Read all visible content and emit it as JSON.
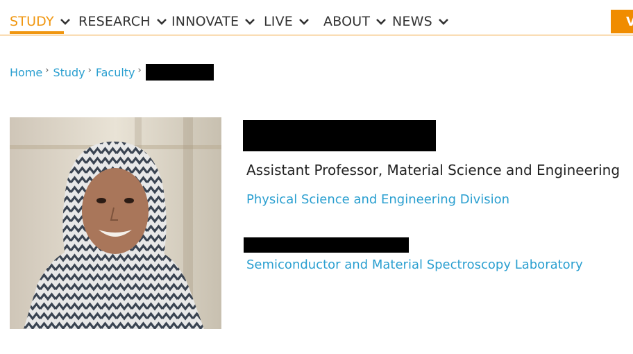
{
  "nav": {
    "items": [
      {
        "label": "STUDY",
        "active": true
      },
      {
        "label": "RESEARCH",
        "active": false
      },
      {
        "label": "INNOVATE",
        "active": false
      },
      {
        "label": "LIVE",
        "active": false
      },
      {
        "label": "ABOUT",
        "active": false
      },
      {
        "label": "NEWS",
        "active": false
      }
    ],
    "cta_label": "V"
  },
  "breadcrumb": {
    "items": [
      "Home",
      "Study",
      "Faculty"
    ],
    "separator": "›"
  },
  "profile": {
    "title": "Assistant Professor, Material Science and Engineering",
    "division": "Physical Science and Engineering Division",
    "lab": "Semiconductor and Material Spectroscopy Laboratory"
  },
  "colors": {
    "accent": "#f0960f",
    "link": "#2a9fd0"
  }
}
